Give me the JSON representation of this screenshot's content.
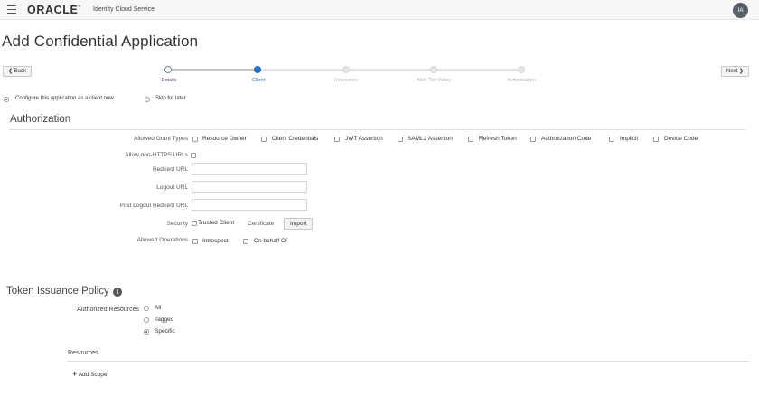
{
  "header": {
    "brand": "ORACLE",
    "product": "Identity Cloud Service",
    "avatar_initials": "IA"
  },
  "page_title": "Add Confidential Application",
  "nav": {
    "back_label": "Back",
    "next_label": "Next"
  },
  "train": {
    "steps": [
      {
        "label": "Details",
        "state": "visited"
      },
      {
        "label": "Client",
        "state": "current"
      },
      {
        "label": "Resources",
        "state": "upcoming"
      },
      {
        "label": "Web Tier Policy",
        "state": "upcoming"
      },
      {
        "label": "Authorization",
        "state": "upcoming"
      }
    ]
  },
  "config_choice": {
    "options": [
      "Configure this application as a client now",
      "Skip for later"
    ],
    "selected": "Configure this application as a client now"
  },
  "authorization": {
    "title": "Authorization",
    "grant_types_label": "Allowed Grant Types",
    "grant_types": [
      "Resource Owner",
      "Client Credentials",
      "JWT Assertion",
      "SAML2 Assertion",
      "Refresh Token",
      "Authorization Code",
      "Implicit",
      "Device Code"
    ],
    "non_https_label": "Allow non-HTTPS URLs",
    "redirect_url_label": "Redirect URL",
    "redirect_url_value": "",
    "logout_url_label": "Logout URL",
    "logout_url_value": "",
    "post_logout_label": "Post Logout Redirect URL",
    "post_logout_value": "",
    "security_label": "Security",
    "trusted_client_label": "Trusted Client",
    "certificate_label": "Certificate",
    "import_label": "Import",
    "allowed_ops_label": "Allowed Operations",
    "ops": [
      "Introspect",
      "On behalf Of"
    ]
  },
  "token_policy": {
    "title": "Token Issuance Policy",
    "info_icon": "i",
    "authorized_resources_label": "Authorized Resources",
    "resource_options": [
      "All",
      "Tagged",
      "Specific"
    ],
    "selected": "Specific",
    "resources_heading": "Resources",
    "add_scope_label": "Add Scope"
  },
  "colors": {
    "accent": "#1f73c8",
    "visited_step": "#5b3b7b",
    "avatar_bg": "#57606a"
  }
}
